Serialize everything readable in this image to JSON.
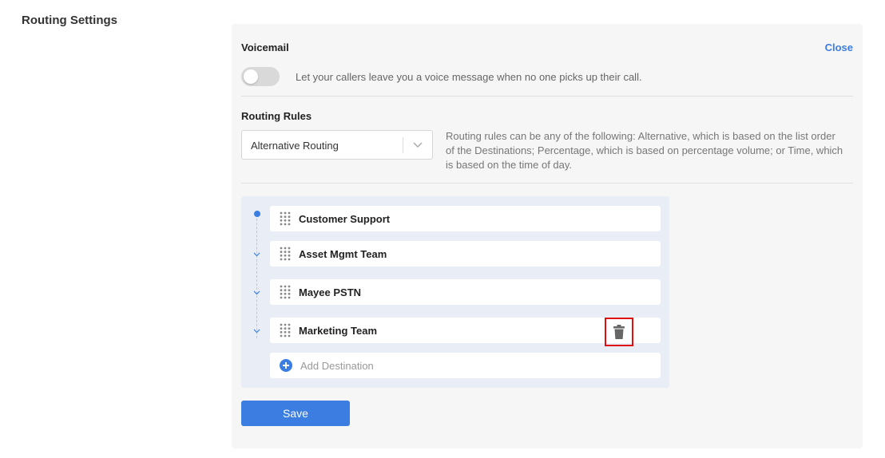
{
  "page": {
    "title": "Routing Settings"
  },
  "voicemail": {
    "title": "Voicemail",
    "close_label": "Close",
    "toggle_on": false,
    "description": "Let your callers leave you a voice message when no one picks up their call."
  },
  "routing_rules": {
    "title": "Routing Rules",
    "selected": "Alternative Routing",
    "description": "Routing rules can be any of the following: Alternative, which is based on the list order of the Destinations; Percentage, which is based on percentage volume; or Time, which is based on the time of day."
  },
  "destinations": [
    {
      "name": "Customer Support"
    },
    {
      "name": "Asset Mgmt Team"
    },
    {
      "name": "Mayee PSTN"
    },
    {
      "name": "Marketing Team"
    }
  ],
  "add_destination_label": "Add Destination",
  "save_label": "Save",
  "icons": {
    "drag": "drag-handle-icon",
    "delete": "trash-icon",
    "add": "plus-circle-icon",
    "dropdown": "chevron-down-icon"
  },
  "colors": {
    "accent": "#3b7de0",
    "highlight": "#e01010"
  }
}
